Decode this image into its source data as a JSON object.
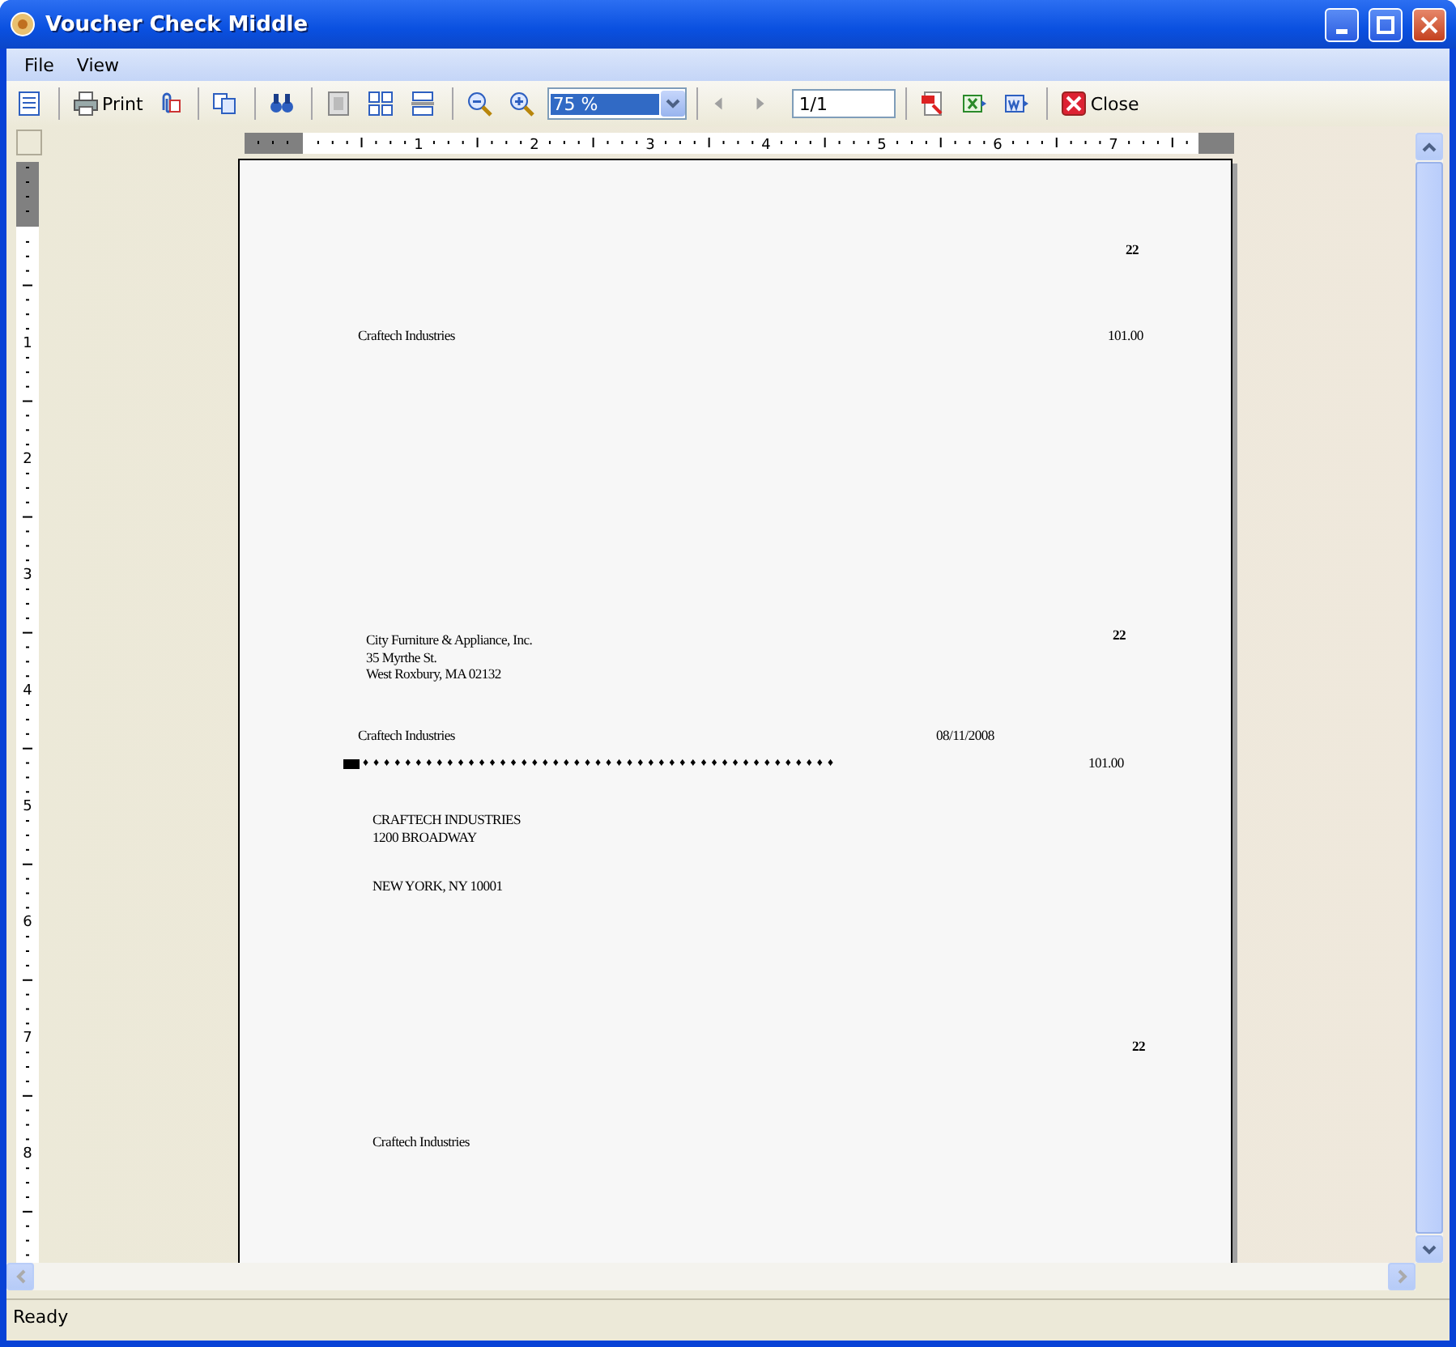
{
  "window": {
    "title": "Voucher Check Middle"
  },
  "menu": [
    "File",
    "View"
  ],
  "toolbar": {
    "print_label": "Print",
    "zoom": {
      "value": "75 %",
      "selected": true
    },
    "previous_disabled": true,
    "next_disabled": true,
    "page_field": "1/1",
    "close_label": "Close"
  },
  "ruler_horizontal": [
    "1",
    "2",
    "3",
    "4",
    "5",
    "6",
    "7"
  ],
  "ruler_vertical": [
    "1",
    "2",
    "3",
    "4",
    "5",
    "6",
    "7",
    "8"
  ],
  "report": [
    {
      "kind": "bold",
      "text": "22"
    },
    {
      "kind": "text",
      "text": "Craftech Industries"
    },
    {
      "kind": "text",
      "text": "101.00"
    },
    {
      "kind": "lines",
      "lines": [
        "City Furniture & Appliance, Inc.",
        "35 Myrthe St.",
        "West Roxbury, MA 02132"
      ]
    },
    {
      "kind": "bold",
      "text": "22"
    },
    {
      "kind": "text",
      "text": "Craftech Industries"
    },
    {
      "kind": "text",
      "text": "08/11/2008"
    },
    {
      "kind": "fill",
      "text": "♦♦♦♦♦♦♦♦♦♦♦♦♦♦♦♦♦♦♦♦♦♦♦♦♦♦♦♦♦♦♦♦♦♦♦♦♦♦♦♦♦♦♦♦♦"
    },
    {
      "kind": "text",
      "text": "101.00"
    },
    {
      "kind": "lines",
      "lines": [
        "CRAFTECH INDUSTRIES",
        "1200 BROADWAY"
      ]
    },
    {
      "kind": "text",
      "text": "NEW YORK, NY 10001"
    },
    {
      "kind": "bold",
      "text": "22"
    },
    {
      "kind": "text",
      "text": "Craftech Industries"
    }
  ],
  "status_bar": "Ready"
}
